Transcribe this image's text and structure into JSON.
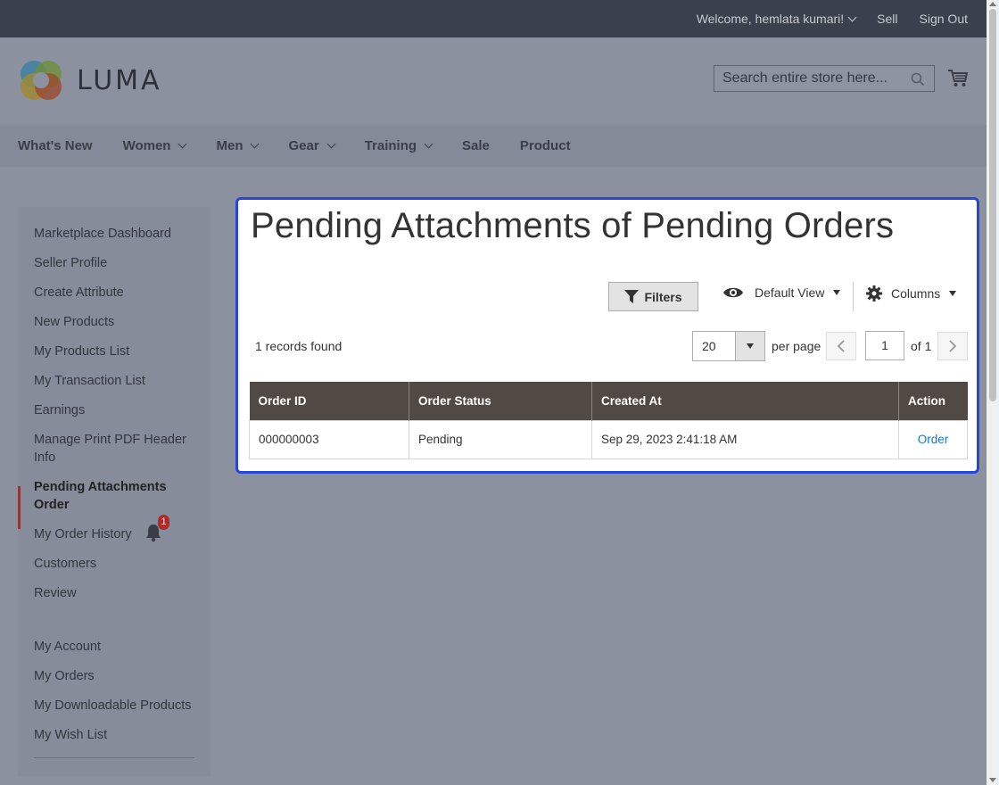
{
  "topbar": {
    "welcome": "Welcome, hemlata kumari!",
    "sell": "Sell",
    "sign_out": "Sign Out"
  },
  "header": {
    "logo_text": "LUMA",
    "search_placeholder": "Search entire store here...",
    "search_icon": "search-icon",
    "cart_icon": "cart-icon"
  },
  "nav": {
    "items": [
      {
        "label": "What's New",
        "dropdown": false
      },
      {
        "label": "Women",
        "dropdown": true
      },
      {
        "label": "Men",
        "dropdown": true
      },
      {
        "label": "Gear",
        "dropdown": true
      },
      {
        "label": "Training",
        "dropdown": true
      },
      {
        "label": "Sale",
        "dropdown": false
      },
      {
        "label": "Product",
        "dropdown": false
      }
    ]
  },
  "sidebar": {
    "items": [
      {
        "label": "Marketplace Dashboard"
      },
      {
        "label": "Seller Profile"
      },
      {
        "label": "Create Attribute"
      },
      {
        "label": "New Products"
      },
      {
        "label": "My Products List"
      },
      {
        "label": "My Transaction List"
      },
      {
        "label": "Earnings"
      },
      {
        "label": "Manage Print PDF Header Info"
      },
      {
        "label": "Pending Attachments Order",
        "active": true
      },
      {
        "label": "My Order History",
        "badge": "1"
      },
      {
        "label": "Customers"
      },
      {
        "label": "Review"
      }
    ],
    "account_items": [
      {
        "label": "My Account"
      },
      {
        "label": "My Orders"
      },
      {
        "label": "My Downloadable Products"
      },
      {
        "label": "My Wish List"
      }
    ],
    "active_accent": "#8a3a3a"
  },
  "main": {
    "title": "Pending Attachments of Pending Orders",
    "filters_label": "Filters",
    "view_label": "Default View",
    "columns_label": "Columns",
    "records_found": "1 records found",
    "per_page_value": "20",
    "per_page_label": "per page",
    "page_current": "1",
    "page_total_label": "of 1",
    "table": {
      "headers": [
        "Order ID",
        "Order Status",
        "Created At",
        "Action"
      ],
      "rows": [
        {
          "order_id": "000000003",
          "status": "Pending",
          "created_at": "Sep 29, 2023 2:41:18 AM",
          "action": "Order"
        }
      ]
    },
    "highlight_color": "#2546d8",
    "header_bg": "#514943",
    "link_color": "#1979c3"
  }
}
